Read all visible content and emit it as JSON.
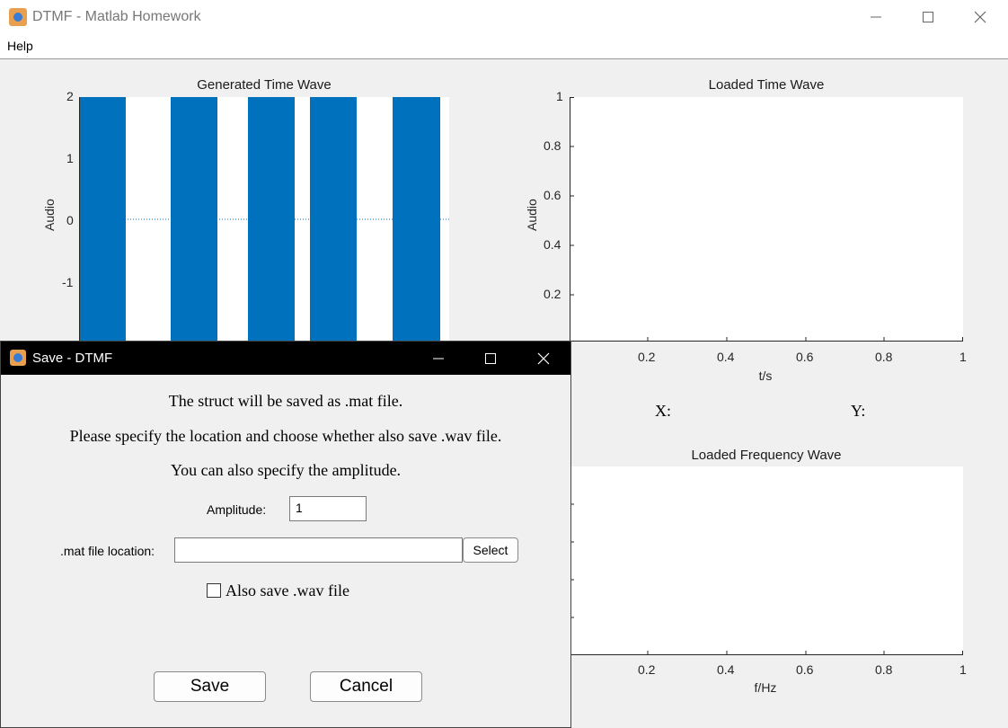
{
  "window": {
    "title": "DTMF - Matlab Homework"
  },
  "menu": {
    "help": "Help"
  },
  "gen_plot": {
    "title": "Generated Time Wave",
    "ylabel": "Audio",
    "yticks": [
      "2",
      "1",
      "0",
      "-1"
    ]
  },
  "loaded_time": {
    "title": "Loaded Time Wave",
    "ylabel": "Audio",
    "xlabel": "t/s",
    "yticks": [
      "1",
      "0.8",
      "0.6",
      "0.4",
      "0.2"
    ],
    "xticks": [
      "0.2",
      "0.4",
      "0.6",
      "0.8",
      "1"
    ]
  },
  "coords": {
    "x_label": "X:",
    "y_label": "Y:"
  },
  "loaded_freq": {
    "title": "Loaded Frequency Wave",
    "xlabel": "f/Hz",
    "xticks": [
      "0.2",
      "0.4",
      "0.6",
      "0.8",
      "1"
    ]
  },
  "dialog": {
    "title": "Save - DTMF",
    "line1": "The struct will be saved as .mat file.",
    "line2": "Please specify the location and choose whether also save .wav file.",
    "line3": "You can also specify the amplitude.",
    "amplitude_label": "Amplitude:",
    "amplitude_value": "1",
    "location_label": ".mat file location:",
    "location_value": "",
    "select_label": "Select",
    "wav_checkbox_label": "Also save .wav file",
    "wav_checked": false,
    "save_label": "Save",
    "cancel_label": "Cancel"
  },
  "colors": {
    "wave": "#0072bd",
    "axis": "#262626"
  },
  "chart_data": [
    {
      "type": "line",
      "title": "Generated Time Wave",
      "ylabel": "Audio",
      "ylim": [
        -2,
        2
      ],
      "series": [
        {
          "values": "five DTMF tone bursts with amplitude ~2 separated by silence"
        }
      ]
    },
    {
      "type": "line",
      "title": "Loaded Time Wave",
      "xlabel": "t/s",
      "ylabel": "Audio",
      "xlim": [
        0,
        1
      ],
      "ylim": [
        0,
        1
      ],
      "series": []
    },
    {
      "type": "line",
      "title": "Loaded Frequency Wave",
      "xlabel": "f/Hz",
      "xlim": [
        0,
        1
      ],
      "series": []
    }
  ]
}
